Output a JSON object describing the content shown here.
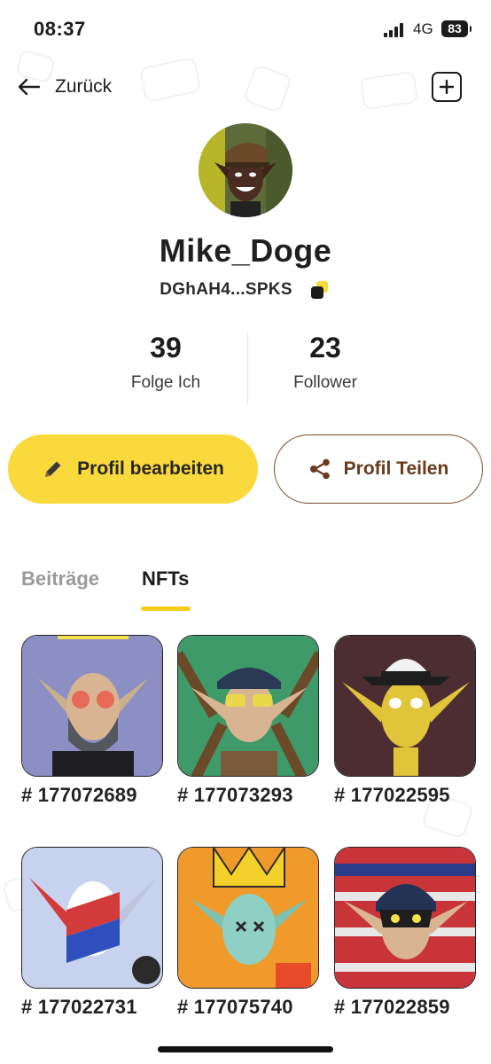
{
  "status_bar": {
    "time": "08:37",
    "network": "4G",
    "battery": "83"
  },
  "header": {
    "back_label": "Zurück"
  },
  "profile": {
    "username": "Mike_Doge",
    "wallet_address": "DGhAH4...SPKS"
  },
  "stats": [
    {
      "value": "39",
      "label": "Folge Ich"
    },
    {
      "value": "23",
      "label": "Follower"
    }
  ],
  "actions": {
    "edit_label": "Profil bearbeiten",
    "share_label": "Profil Teilen"
  },
  "colors": {
    "accent_yellow": "#fad93c",
    "share_brown": "#7a4a26",
    "tab_underline": "#f5cd1a"
  },
  "tabs": [
    {
      "label": "Beiträge",
      "active": false
    },
    {
      "label": "NFTs",
      "active": true
    }
  ],
  "nfts": [
    {
      "label": "# 177072689"
    },
    {
      "label": "# 177073293"
    },
    {
      "label": "# 177022595"
    },
    {
      "label": "# 177022731"
    },
    {
      "label": "# 177075740"
    },
    {
      "label": "# 177022859"
    }
  ]
}
